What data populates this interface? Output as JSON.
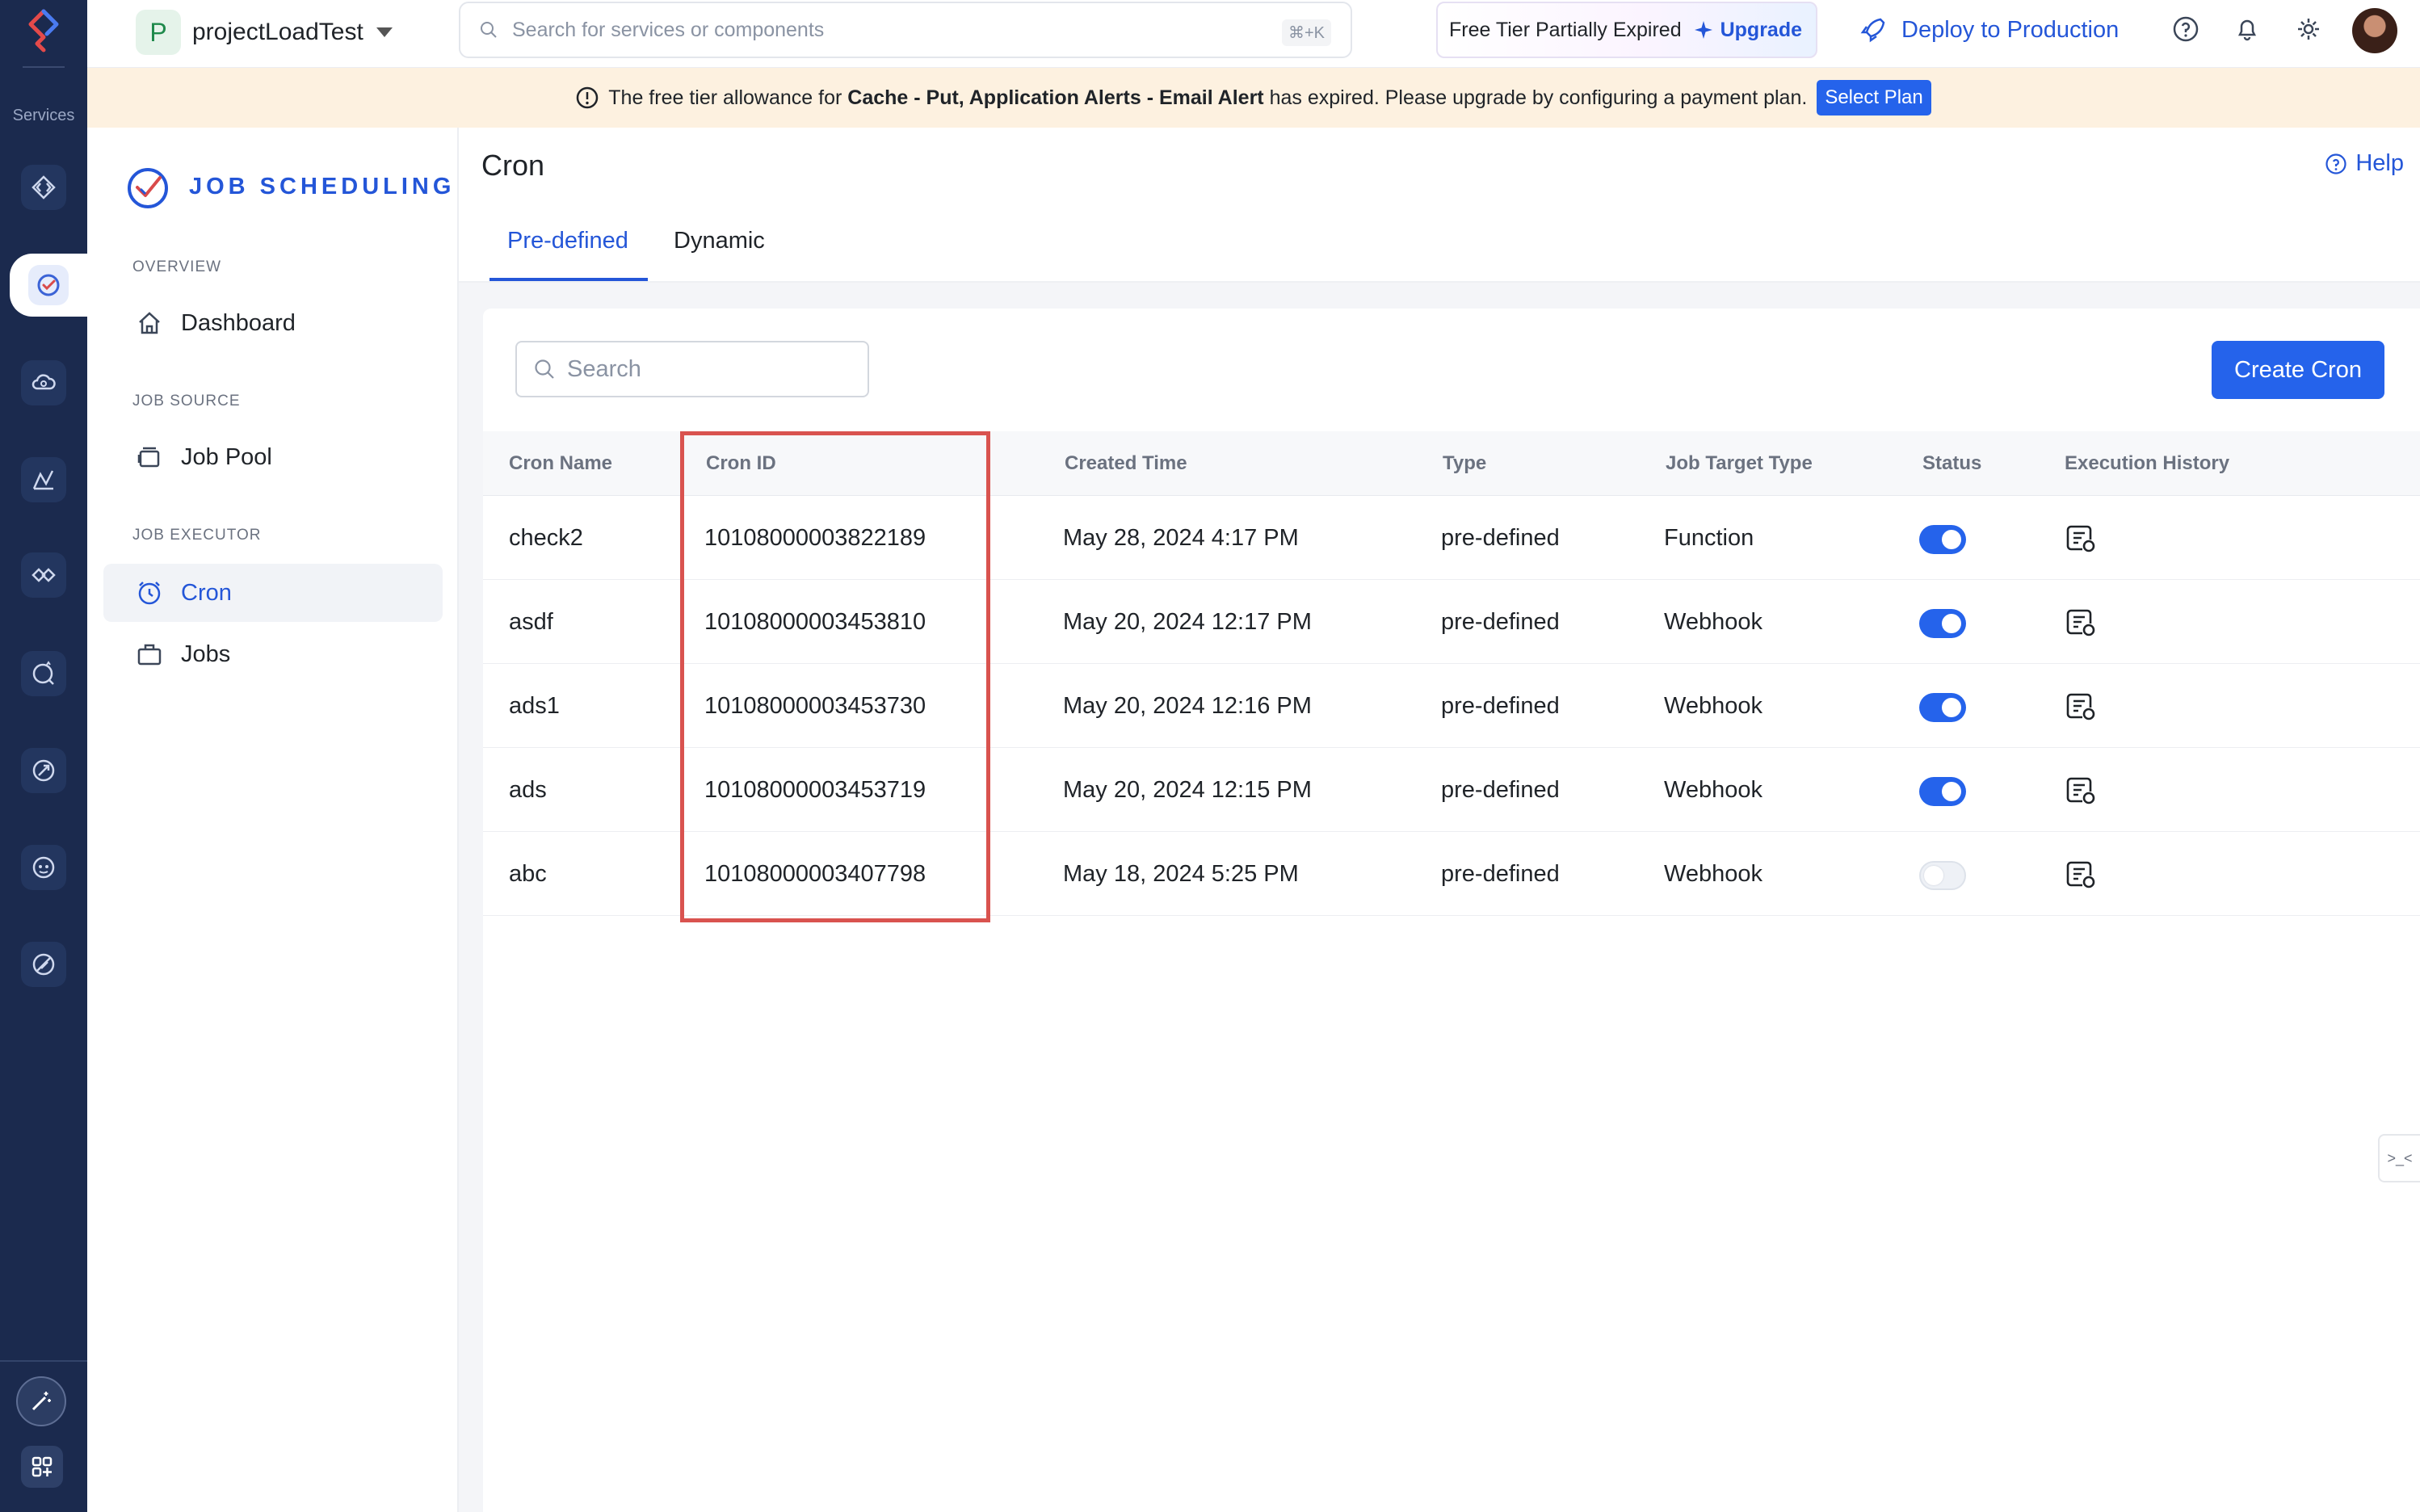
{
  "rail": {
    "services_label": "Services",
    "icons": [
      "serverless-icon",
      "job-scheduling-icon",
      "cloud-scale-icon",
      "analytics-icon",
      "integrations-icon",
      "quick-ml-icon",
      "devops-icon",
      "zia-icon",
      "signals-icon"
    ]
  },
  "topbar": {
    "project_badge": "P",
    "project_name": "projectLoadTest",
    "search_placeholder": "Search for services or components",
    "search_shortcut": "⌘+K",
    "tier_text": "Free Tier Partially Expired",
    "upgrade_label": "Upgrade",
    "deploy_label": "Deploy to Production"
  },
  "banner": {
    "prefix": "The free tier allowance for",
    "services": "Cache - Put, Application Alerts - Email Alert",
    "suffix": "has expired. Please upgrade by configuring a payment plan.",
    "select_plan_label": "Select Plan"
  },
  "sidebar": {
    "brand": "JOB SCHEDULING",
    "sections": [
      {
        "title": "OVERVIEW",
        "items": [
          {
            "label": "Dashboard",
            "icon": "home-icon"
          }
        ]
      },
      {
        "title": "JOB SOURCE",
        "items": [
          {
            "label": "Job Pool",
            "icon": "job-pool-icon"
          }
        ]
      },
      {
        "title": "JOB EXECUTOR",
        "items": [
          {
            "label": "Cron",
            "icon": "alarm-clock-icon",
            "active": true
          },
          {
            "label": "Jobs",
            "icon": "briefcase-icon"
          }
        ]
      }
    ]
  },
  "main": {
    "title": "Cron",
    "help_label": "Help",
    "tabs": [
      {
        "label": "Pre-defined",
        "active": true
      },
      {
        "label": "Dynamic"
      }
    ],
    "search_placeholder": "Search",
    "create_label": "Create Cron",
    "columns": [
      "Cron Name",
      "Cron ID",
      "Created Time",
      "Type",
      "Job Target Type",
      "Status",
      "Execution History"
    ],
    "rows": [
      {
        "name": "check2",
        "id": "10108000003822189",
        "created": "May 28, 2024 4:17 PM",
        "type": "pre-defined",
        "target": "Function",
        "status": true
      },
      {
        "name": "asdf",
        "id": "10108000003453810",
        "created": "May 20, 2024 12:17 PM",
        "type": "pre-defined",
        "target": "Webhook",
        "status": true
      },
      {
        "name": "ads1",
        "id": "10108000003453730",
        "created": "May 20, 2024 12:16 PM",
        "type": "pre-defined",
        "target": "Webhook",
        "status": true
      },
      {
        "name": "ads",
        "id": "10108000003453719",
        "created": "May 20, 2024 12:15 PM",
        "type": "pre-defined",
        "target": "Webhook",
        "status": true
      },
      {
        "name": "abc",
        "id": "10108000003407798",
        "created": "May 18, 2024 5:25 PM",
        "type": "pre-defined",
        "target": "Webhook",
        "status": false
      }
    ],
    "edge_tab_label": ">_<"
  },
  "colors": {
    "accent": "#2563eb",
    "rail": "#1b2a4e",
    "banner": "#fdf1e0",
    "highlight_box": "#d9534f"
  }
}
